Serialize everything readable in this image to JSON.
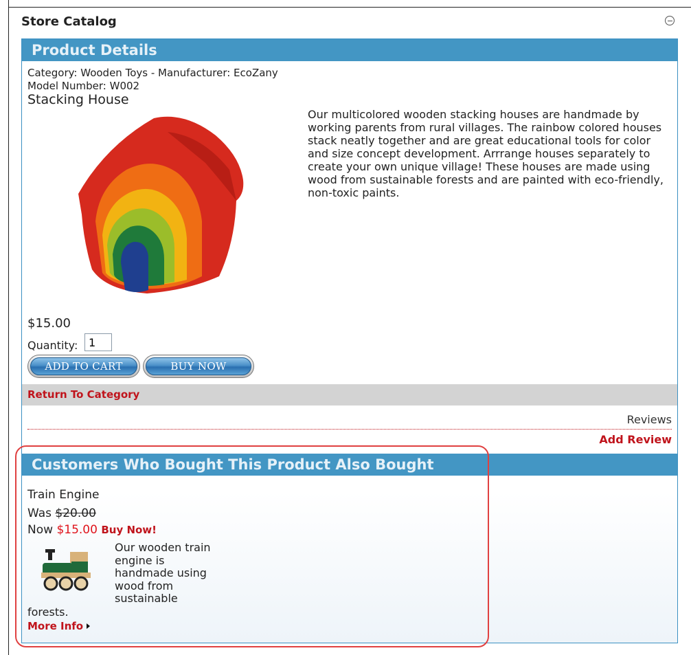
{
  "module": {
    "title": "Store Catalog"
  },
  "product_details": {
    "header": "Product Details",
    "category_line": "Category: Wooden Toys - Manufacturer: EcoZany",
    "model_line": "Model Number: W002",
    "name": "Stacking House",
    "description": "Our multicolored wooden stacking houses are handmade by working parents from rural villages. The rainbow colored houses stack neatly together and are great educational tools for color and size concept development. Arrrange houses separately to create your own unique village! These houses are made using wood from sustainable forests and are painted with eco-friendly, non-toxic paints.",
    "price": "$15.00",
    "quantity_label": "Quantity:",
    "quantity_value": "1",
    "add_to_cart_label": "ADD TO CART",
    "buy_now_label": "BUY NOW",
    "return_link": "Return To Category",
    "reviews_label": "Reviews",
    "add_review_link": "Add Review"
  },
  "also_bought": {
    "header": "Customers Who Bought This Product Also Bought",
    "items": [
      {
        "name": "Train Engine",
        "was_label": "Was",
        "old_price": "$20.00",
        "now_label": "Now",
        "new_price": "$15.00",
        "buy_link": "Buy Now!",
        "description_main": "Our wooden train engine is handmade using wood from sustainable",
        "description_tail": "forests.",
        "more_info_link": "More Info"
      }
    ]
  },
  "colors": {
    "header_blue": "#4396c4",
    "link_red": "#c0141c",
    "price_red": "#e0141c",
    "highlight_red": "#e04040"
  }
}
